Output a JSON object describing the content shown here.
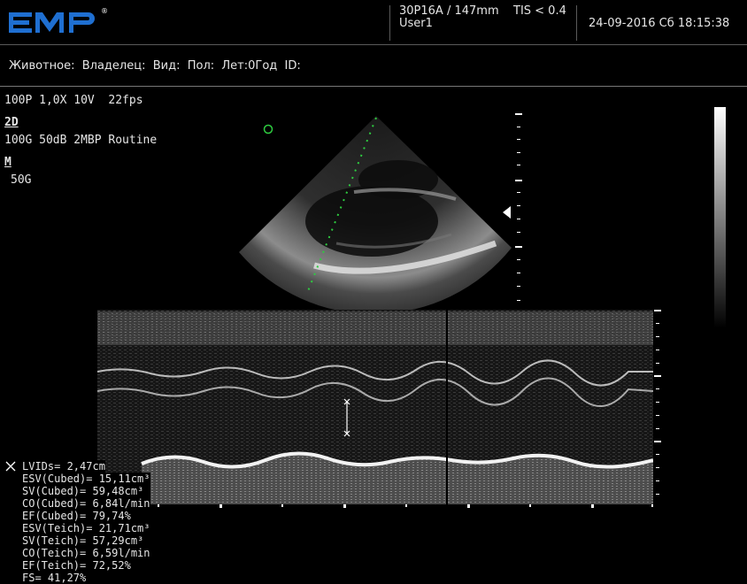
{
  "brand": {
    "logo_text": "EMP",
    "registered": "®"
  },
  "header": {
    "probe": "30P16A / 147mm",
    "tis": "TIS < 0.4",
    "user": "User1",
    "datetime": "24-09-2016 Сб 18:15:38"
  },
  "patient": {
    "line": "Животное:  Владелец:  Вид:  Пол:  Лет:0Год  ID:"
  },
  "params": {
    "global": "100P 1,0X 10V  22fps",
    "mode_2d": "2D",
    "settings_2d": "100G 50dB 2MBP Routine",
    "mode_m": "M",
    "settings_m": "50G"
  },
  "measurements": {
    "lvids": "LVIDs= 2,47cm",
    "results": [
      "ESV(Cubed)= 15,11cm³",
      "SV(Cubed)= 59,48cm³",
      "CO(Cubed)= 6,84l/min",
      "EF(Cubed)= 79,74%",
      "ESV(Teich)= 21,71cm³",
      "SV(Teich)= 57,29cm³",
      "CO(Teich)= 6,59l/min",
      "EF(Teich)= 72,52%",
      "FS= 41,27%"
    ]
  },
  "colors": {
    "logo_blue": "#1f6fd1",
    "cursor_green": "#2ecc40",
    "text": "#e6e6e6"
  },
  "icons": {
    "focus_marker": "triangle-left",
    "caliper": "x-cross",
    "roi": "circle"
  }
}
